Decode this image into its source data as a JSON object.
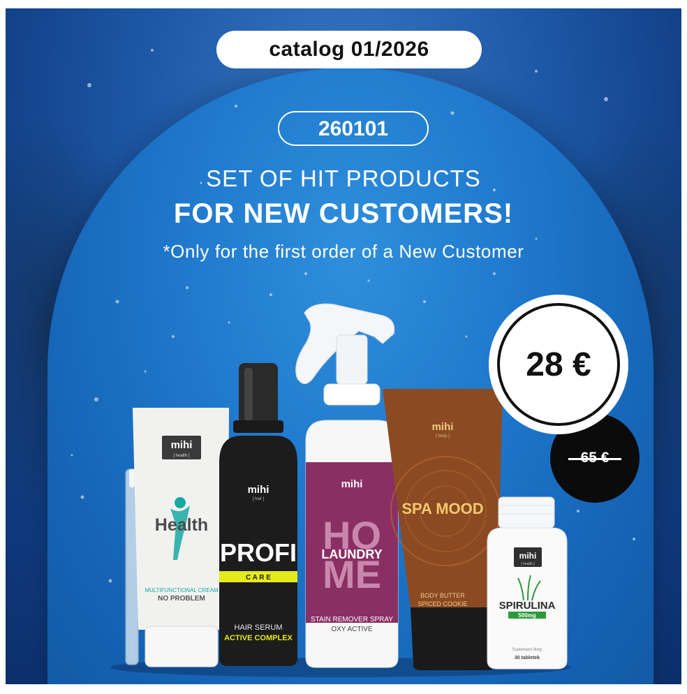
{
  "catalog_label": "catalog 01/2026",
  "product_code": "260101",
  "headline_line1": "SET OF HIT PRODUCTS",
  "headline_line2": "FOR NEW CUSTOMERS!",
  "note": "*Only for the first order of a New Customer",
  "price_new": "28 €",
  "price_old": "65 €",
  "colors": {
    "background": "#1e5aa8",
    "arch": "#1f78cc",
    "profi_yellow": "#e5ea1b",
    "home_purple": "#8a2f63",
    "spa_brown": "#8b4a22",
    "spirulina_green": "#2d9a3a"
  },
  "products": {
    "health": {
      "brand": "mihi",
      "sub": "[ health ]",
      "name": "Health",
      "line1": "MULTIFUNCTIONAL CREAM",
      "line2": "NO PROBLEM"
    },
    "profi": {
      "brand": "mihi",
      "sub": "[ hair ]",
      "name": "PROFI",
      "band": "C A R E",
      "line1": "HAIR SERUM",
      "line2": "ACTIVE COMPLEX"
    },
    "home": {
      "brand": "mihi",
      "big1": "HO",
      "big2": "ME",
      "name": "LAUNDRY",
      "line1": "STAIN REMOVER SPRAY",
      "line2": "OXY ACTIVE"
    },
    "spa": {
      "brand": "mihi",
      "sub": "[ body ]",
      "name": "SPA MOOD",
      "line1": "BODY BUTTER",
      "line2": "SPICED COOKIE"
    },
    "spirulina": {
      "brand": "mihi",
      "sub": "[ health ]",
      "name": "SPIRULINA",
      "dose": "500mg",
      "line1": "Suplement diety",
      "line2": "30 tabletek"
    }
  }
}
